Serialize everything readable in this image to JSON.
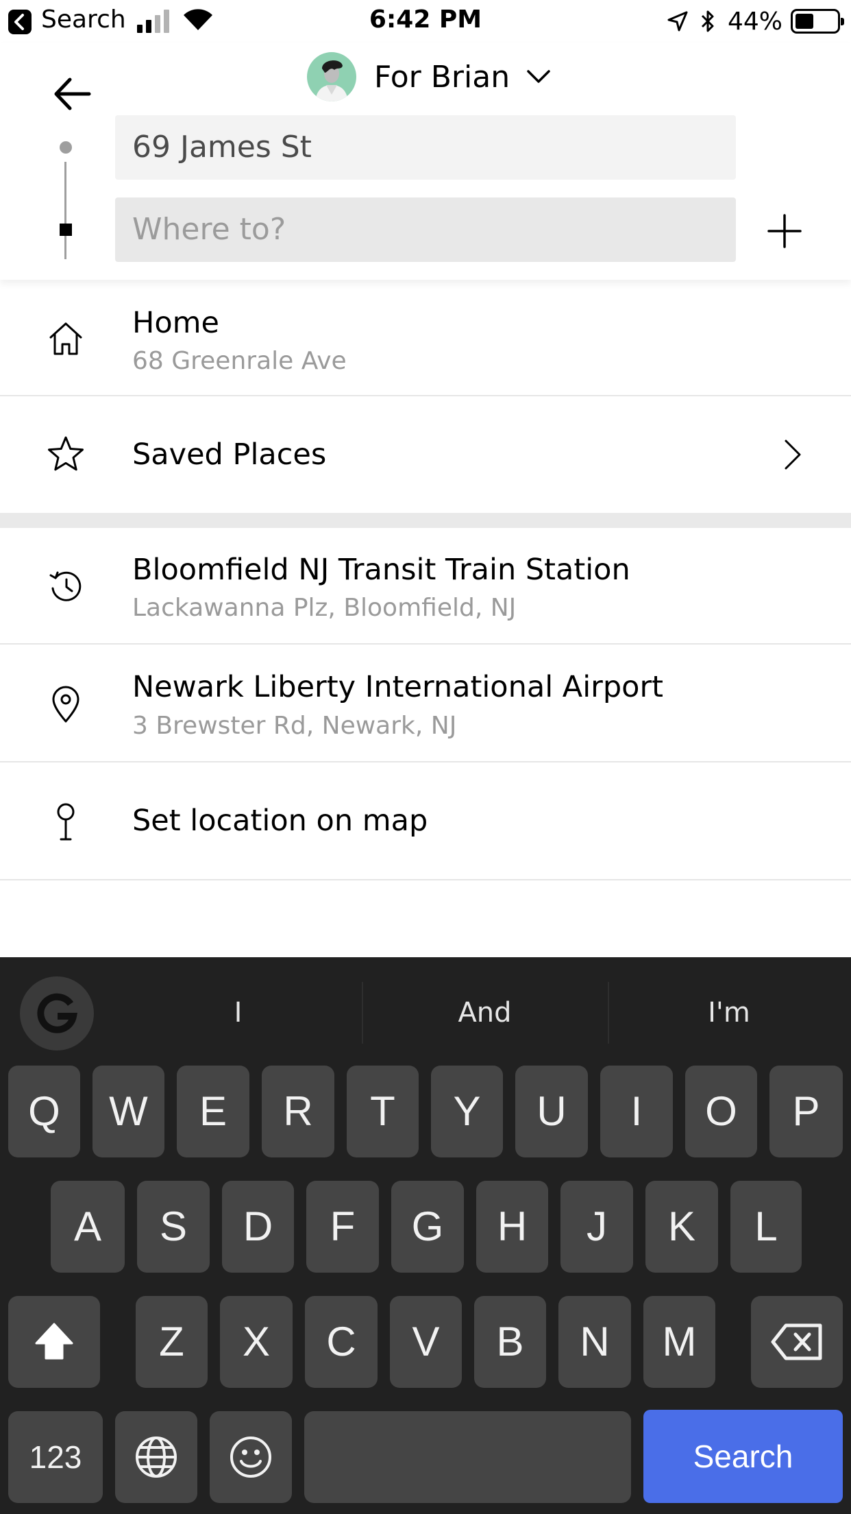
{
  "status_bar": {
    "back_app": "Search",
    "time": "6:42 PM",
    "battery_percent": "44%",
    "battery_level": 0.44
  },
  "header": {
    "rider_label": "For Brian",
    "pickup_value": "69 James St",
    "destination_placeholder": "Where to?"
  },
  "shortcuts": [
    {
      "icon": "home-icon",
      "title": "Home",
      "subtitle": "68 Greenrale Ave"
    },
    {
      "icon": "star-icon",
      "title": "Saved Places"
    }
  ],
  "recents": [
    {
      "icon": "history-icon",
      "title": "Bloomfield NJ Transit Train Station",
      "subtitle": "Lackawanna Plz, Bloomfield, NJ"
    },
    {
      "icon": "location-pin-icon",
      "title": "Newark Liberty International Airport",
      "subtitle": "3 Brewster Rd, Newark, NJ"
    },
    {
      "icon": "map-pin-icon",
      "title": "Set location on map"
    }
  ],
  "keyboard": {
    "suggestions": [
      "I",
      "And",
      "I'm"
    ],
    "row1": [
      "Q",
      "W",
      "E",
      "R",
      "T",
      "Y",
      "U",
      "I",
      "O",
      "P"
    ],
    "row2": [
      "A",
      "S",
      "D",
      "F",
      "G",
      "H",
      "J",
      "K",
      "L"
    ],
    "row3": [
      "Z",
      "X",
      "C",
      "V",
      "B",
      "N",
      "M"
    ],
    "numbers_key": "123",
    "action_key": "Search",
    "accent_color": "#4a6ee8"
  }
}
